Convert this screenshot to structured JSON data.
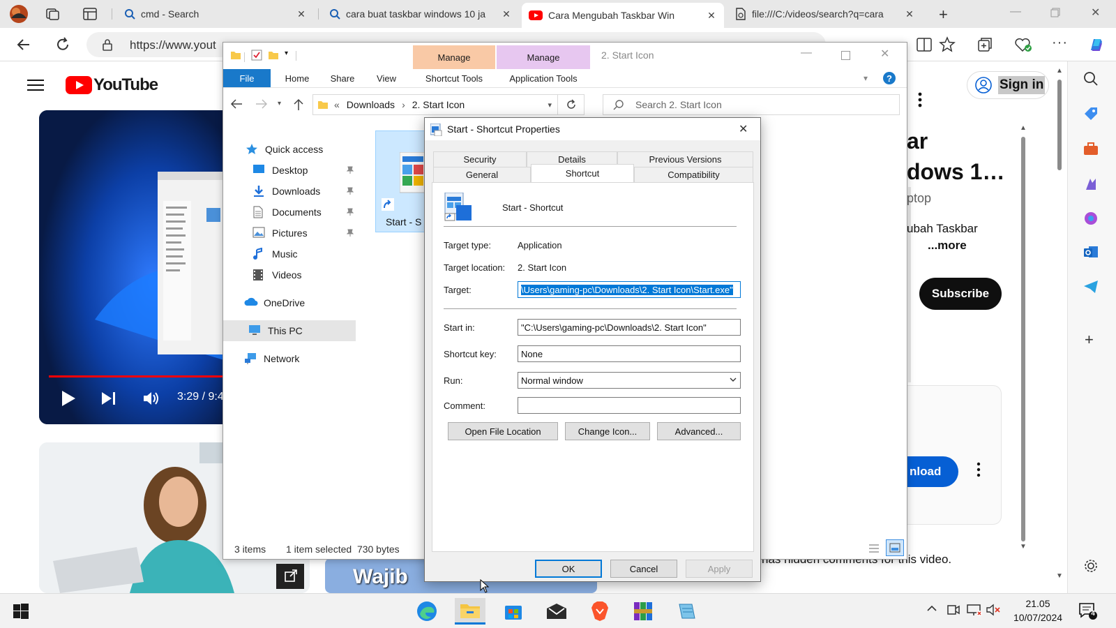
{
  "browser": {
    "tabs": [
      {
        "title": "cmd - Search",
        "icon": "search-icon"
      },
      {
        "title": "cara buat taskbar windows 10 ja",
        "icon": "search-icon"
      },
      {
        "title": "Cara Mengubah Taskbar Win",
        "icon": "youtube-icon"
      },
      {
        "title": "file:///C:/videos/search?q=cara",
        "icon": "file-icon"
      }
    ],
    "url": "https://www.yout"
  },
  "youtube": {
    "logo_text": "YouTube",
    "sign_in": "Sign in",
    "video_time": "3:29 / 9:4",
    "title_fragments": [
      "ar",
      "dows 1…",
      "ptop"
    ],
    "desc_fragment": "ubah Taskbar",
    "more": "...more",
    "subscribe": "Subscribe",
    "download": "nload",
    "comments_note": "has hidden comments for this video.",
    "thumb_text": "Wajib"
  },
  "explorer": {
    "title": "2. Start Icon",
    "ribbon_tabs": [
      "File",
      "Home",
      "Share",
      "View",
      "Shortcut Tools",
      "Application Tools"
    ],
    "context_tabs": [
      "Manage",
      "Manage"
    ],
    "breadcrumb": [
      "Downloads",
      "2. Start Icon"
    ],
    "search_placeholder": "Search 2. Start Icon",
    "nav": [
      {
        "label": "Quick access",
        "icon": "star-icon"
      },
      {
        "label": "Desktop",
        "icon": "desktop-icon",
        "pinned": true
      },
      {
        "label": "Downloads",
        "icon": "download-icon",
        "pinned": true
      },
      {
        "label": "Documents",
        "icon": "documents-icon",
        "pinned": true
      },
      {
        "label": "Pictures",
        "icon": "pictures-icon",
        "pinned": true
      },
      {
        "label": "Music",
        "icon": "music-icon"
      },
      {
        "label": "Videos",
        "icon": "videos-icon"
      },
      {
        "label": "OneDrive",
        "icon": "cloud-icon"
      },
      {
        "label": "This PC",
        "icon": "pc-icon"
      },
      {
        "label": "Network",
        "icon": "network-icon"
      }
    ],
    "file_label": "Start - S",
    "status": {
      "items": "3 items",
      "selected": "1 item selected  730 bytes"
    }
  },
  "dialog": {
    "title": "Start - Shortcut Properties",
    "tabs_top": [
      "Security",
      "Details",
      "Previous Versions"
    ],
    "tabs_bottom": [
      "General",
      "Shortcut",
      "Compatibility"
    ],
    "name": "Start - Shortcut",
    "fields": {
      "target_type_label": "Target type:",
      "target_type": "Application",
      "target_location_label": "Target location:",
      "target_location": "2. Start Icon",
      "target_label": "Target:",
      "target": "\\Users\\gaming-pc\\Downloads\\2. Start Icon\\Start.exe\"",
      "start_in_label": "Start in:",
      "start_in": "\"C:\\Users\\gaming-pc\\Downloads\\2. Start Icon\"",
      "shortcut_key_label": "Shortcut key:",
      "shortcut_key": "None",
      "run_label": "Run:",
      "run": "Normal window",
      "comment_label": "Comment:",
      "comment": ""
    },
    "buttons": {
      "open_location": "Open File Location",
      "change_icon": "Change Icon...",
      "advanced": "Advanced...",
      "ok": "OK",
      "cancel": "Cancel",
      "apply": "Apply"
    }
  },
  "taskbar": {
    "time": "21.05",
    "date": "10/07/2024",
    "notification_count": "4"
  },
  "colors": {
    "accent": "#0078d7",
    "manage_shortcut": "#f9c9a6",
    "manage_app": "#e7c7f0",
    "youtube_red": "#ff0000"
  }
}
